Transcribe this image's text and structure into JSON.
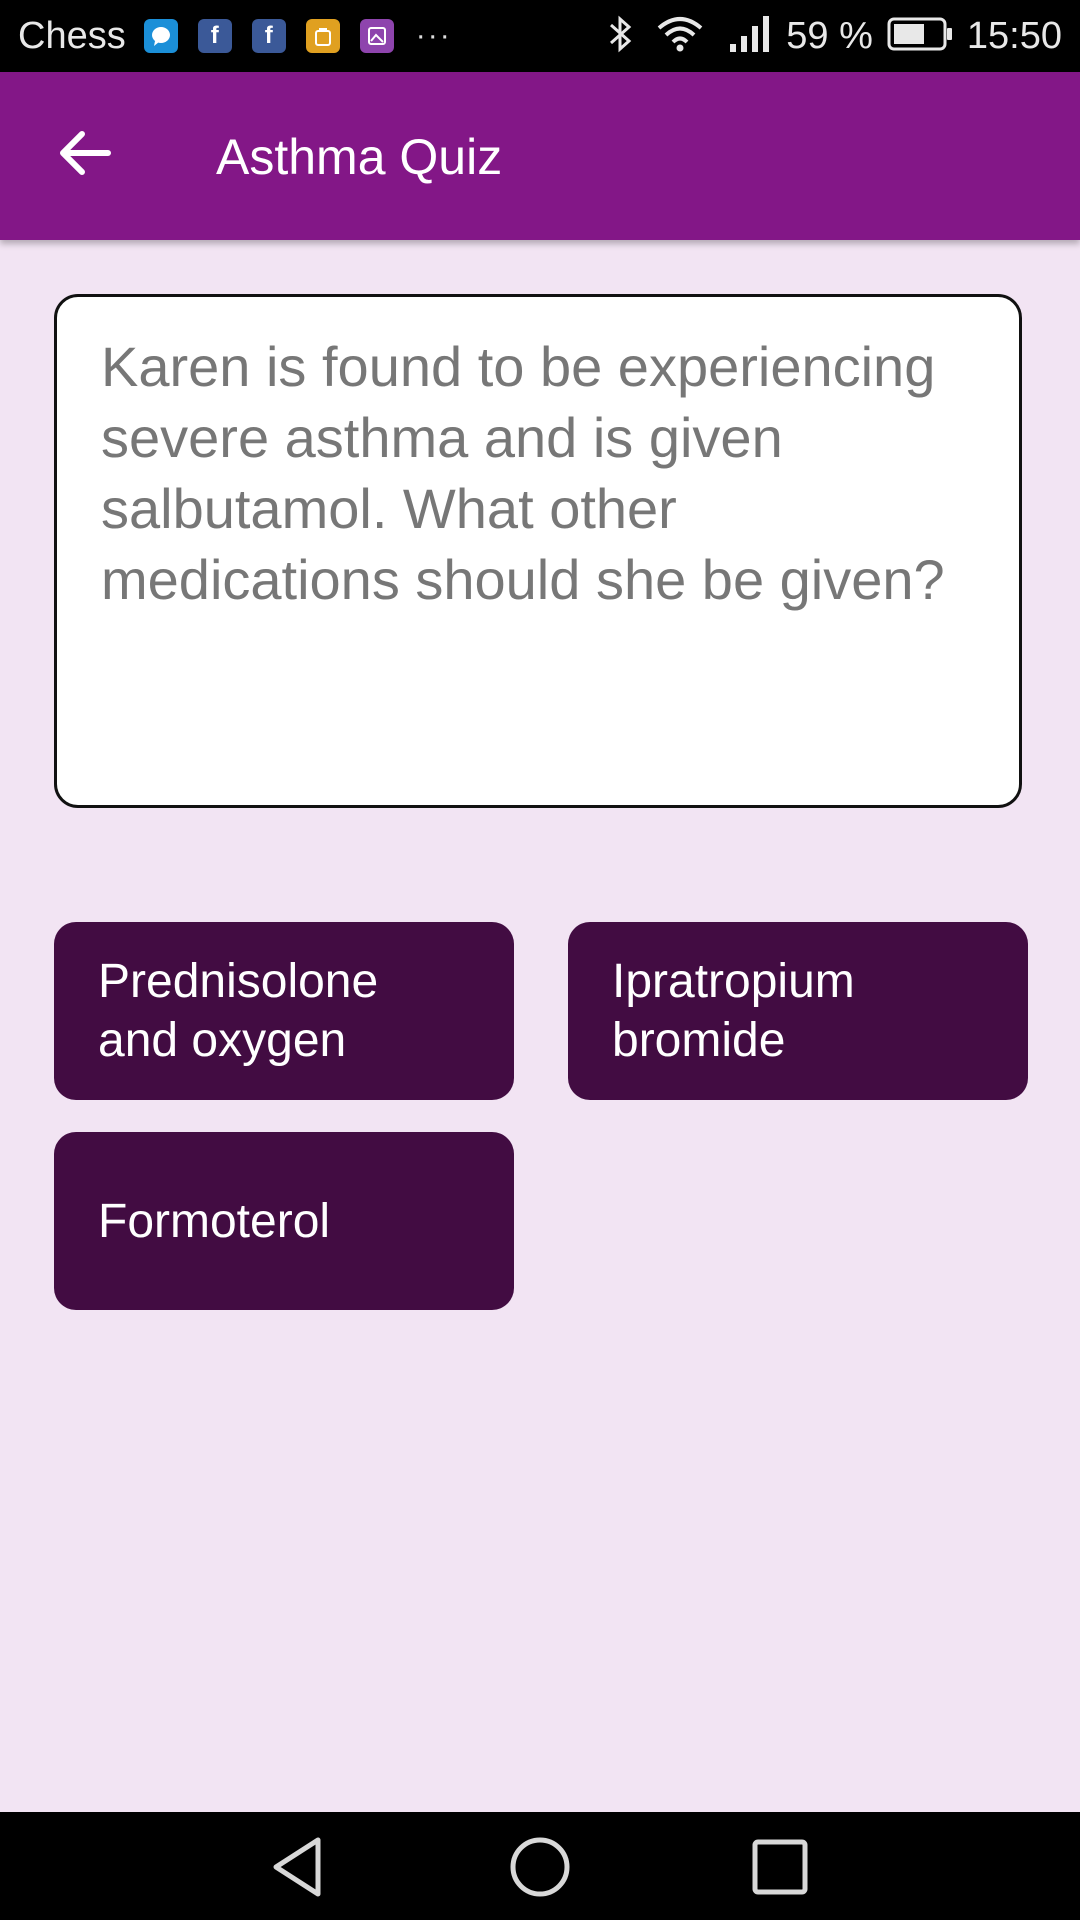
{
  "status_bar": {
    "carrier": "Chess",
    "more": "···",
    "battery": "59 %",
    "time": "15:50",
    "notification_icons": [
      "messenger-icon",
      "facebook-icon",
      "facebook-icon",
      "store-icon",
      "gallery-icon"
    ]
  },
  "app_bar": {
    "title": "Asthma Quiz"
  },
  "question": {
    "text": "Karen is found to be experiencing severe asthma and is given salbutamol. What other medications should she be given?"
  },
  "answers": [
    {
      "label": "Prednisolone and oxygen"
    },
    {
      "label": "Ipratropium bromide"
    },
    {
      "label": "Formoterol"
    }
  ],
  "colors": {
    "app_bar": "#831787",
    "background": "#f2e4f3",
    "answer_button": "#420c42"
  }
}
